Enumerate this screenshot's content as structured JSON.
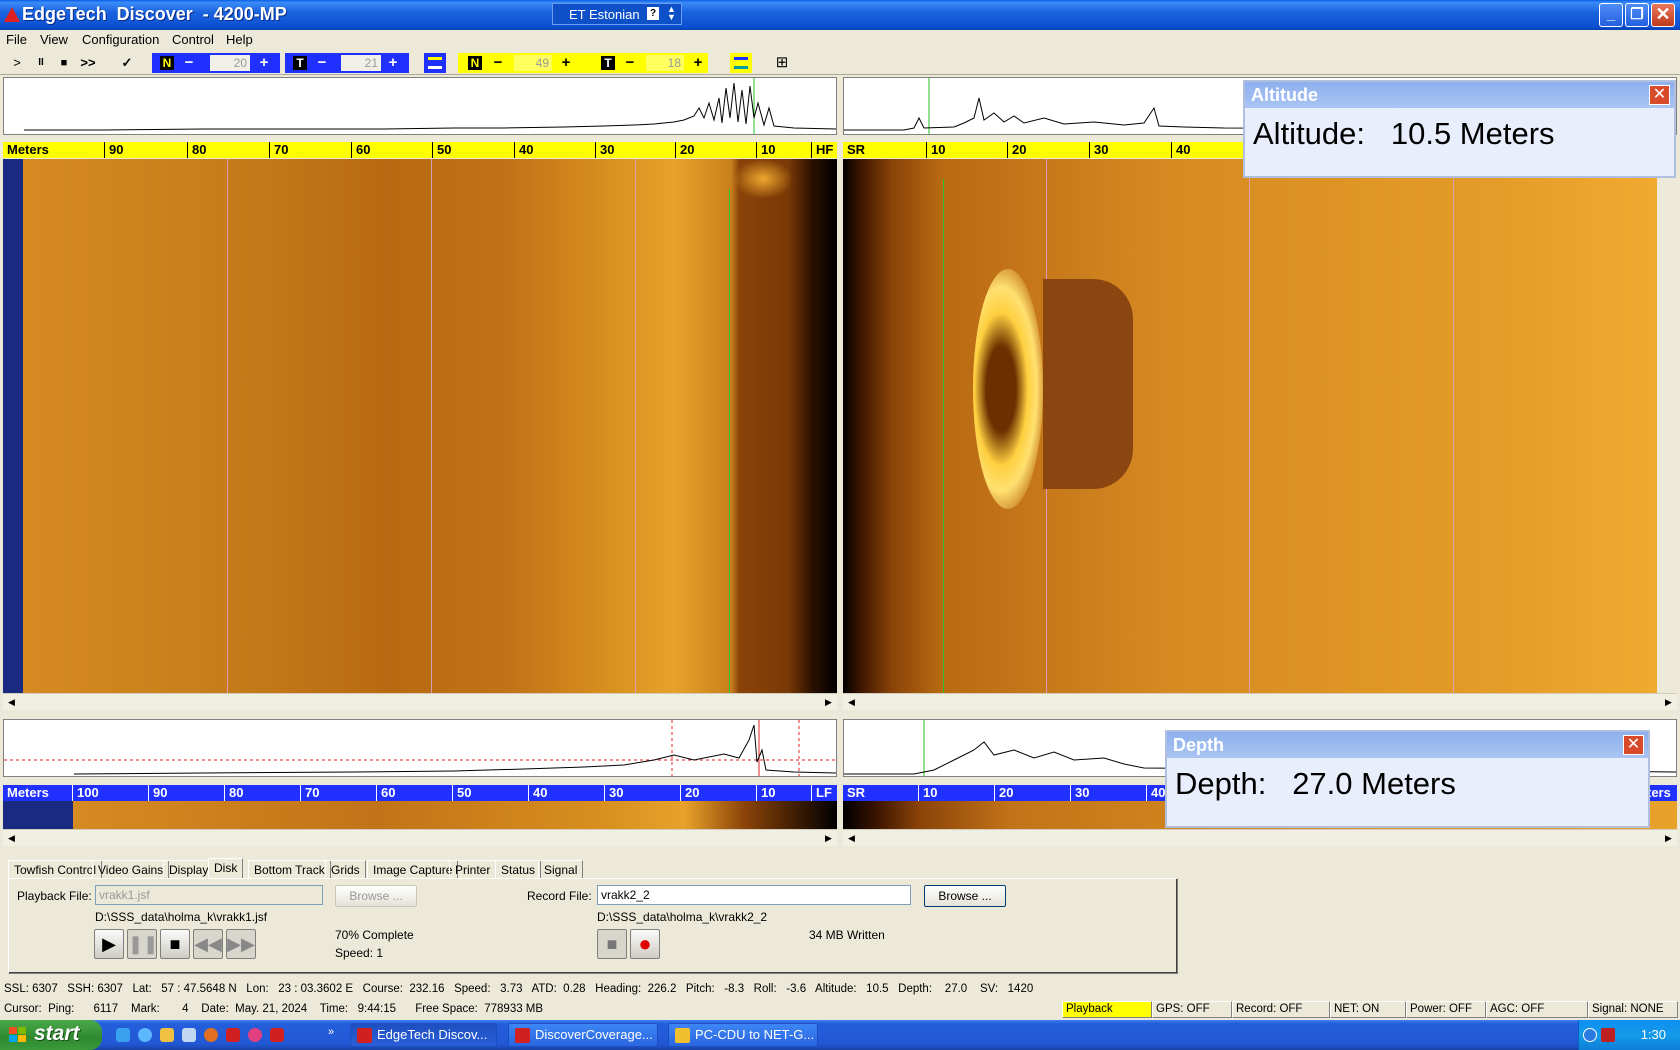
{
  "window": {
    "title": "EdgeTech  Discover  - 4200-MP",
    "language": "ET Estonian",
    "lang_help": "?"
  },
  "menu": [
    "File",
    "View",
    "Configuration",
    "Control",
    "Help"
  ],
  "toolbar": {
    "play": ">",
    "pause": "II",
    "stop": "■",
    "fast": ">>",
    "check": "✓",
    "hf_gain_n": {
      "letter": "N",
      "value": "20"
    },
    "hf_gain_t": {
      "letter": "T",
      "value": "21"
    },
    "lf_gain_n": {
      "letter": "N",
      "value": "49"
    },
    "lf_gain_t": {
      "letter": "T",
      "value": "18"
    },
    "minus": "−",
    "plus": "+"
  },
  "hf_panel": {
    "port_ruler": {
      "label": "Meters",
      "ticks": [
        "90",
        "80",
        "70",
        "60",
        "50",
        "40",
        "30",
        "20",
        "10"
      ],
      "end_label": "HF"
    },
    "stbd_ruler": {
      "label": "SR",
      "ticks": [
        "10",
        "20",
        "30",
        "40"
      ]
    }
  },
  "lf_panel": {
    "port_ruler": {
      "label": "Meters",
      "ticks": [
        "100",
        "90",
        "80",
        "70",
        "60",
        "50",
        "40",
        "30",
        "20",
        "10"
      ],
      "end_label": "LF"
    },
    "stbd_ruler": {
      "label": "SR",
      "ticks": [
        "10",
        "20",
        "30",
        "40"
      ],
      "end_label": "ters"
    }
  },
  "altitude_overlay": {
    "title": "Altitude",
    "label": "Altitude:",
    "value": "10.5 Meters"
  },
  "depth_overlay": {
    "title": "Depth",
    "label": "Depth:",
    "value": "27.0 Meters"
  },
  "tabs": [
    "Towfish Control",
    "Video Gains",
    "Display",
    "Disk",
    "Bottom Track",
    "Grids",
    "Image Capture",
    "Printer",
    "Status",
    "Signal"
  ],
  "active_tab": "Disk",
  "disk": {
    "playback_label": "Playback File:",
    "playback_value": "vrakk1.jsf",
    "playback_browse": "Browse ...",
    "playback_path": "D:\\SSS_data\\holma_k\\vrakk1.jsf",
    "progress": "70% Complete",
    "speed": "Speed: 1",
    "record_label": "Record File:",
    "record_value": "vrakk2_2",
    "record_browse": "Browse ...",
    "record_path": "D:\\SSS_data\\holma_k\\vrakk2_2",
    "written": "34 MB Written"
  },
  "status": {
    "line1": "SSL: 6307   SSH: 6307   Lat:   57 : 47.5648 N   Lon:   23 : 03.3602 E   Course:  232.16   Speed:   3.73   ATD:  0.28   Heading:  226.2   Pitch:   -8.3   Roll:   -3.6   Altitude:   10.5   Depth:    27.0    SV:   1420",
    "line2": "Cursor:  Ping:      6117    Mark:       4    Date:  May. 21, 2024    Time:   9:44:15      Free Space:  778933 MB",
    "boxes": [
      "Playback",
      "GPS: OFF",
      "Record: OFF",
      "NET: ON",
      "Power: OFF",
      "AGC: OFF",
      "Signal: NONE"
    ]
  },
  "taskbar": {
    "start": "start",
    "tasks": [
      "EdgeTech  Discov...",
      "DiscoverCoverage...",
      "PC-CDU to NET-G..."
    ],
    "clock": "1:30"
  },
  "colors": {
    "accent_blue": "#1f30ff",
    "accent_yellow": "#ffff00",
    "sonar_bright": "#f0a020",
    "sonar_dark": "#8a4208"
  }
}
